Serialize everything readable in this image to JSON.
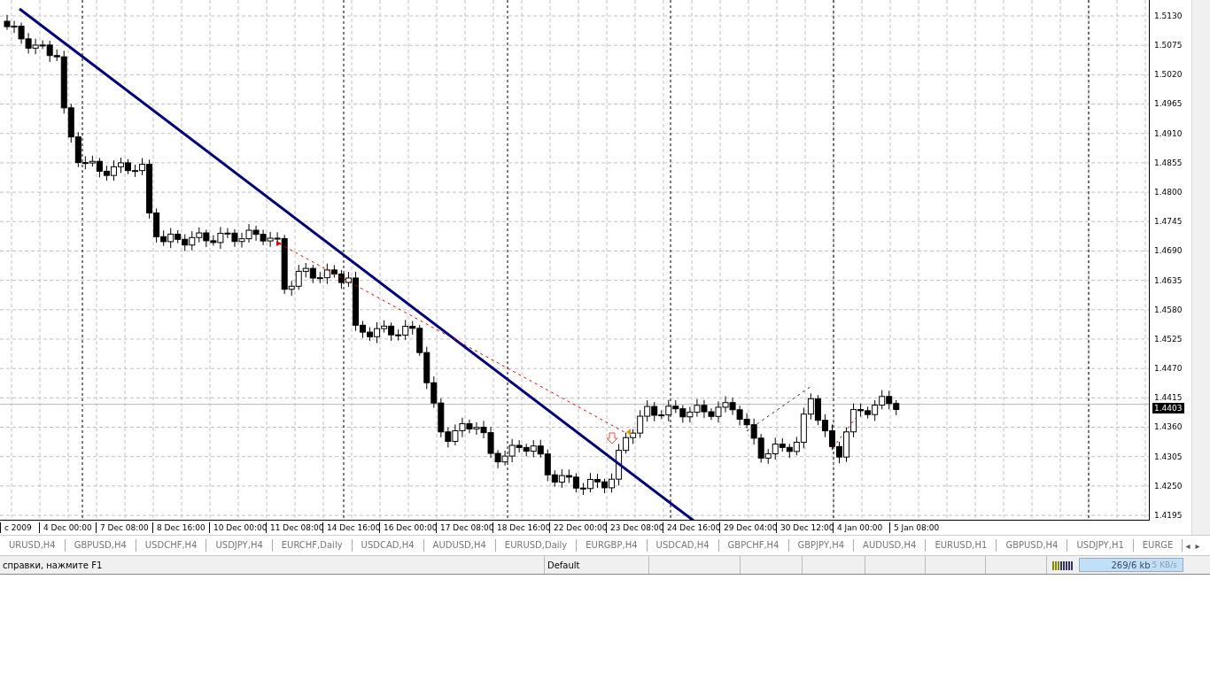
{
  "chart": {
    "price_labels": [
      "1.5130",
      "1.5075",
      "1.5020",
      "1.4965",
      "1.4910",
      "1.4855",
      "1.4800",
      "1.4745",
      "1.4690",
      "1.4635",
      "1.4580",
      "1.4525",
      "1.4470",
      "1.4415",
      "1.4360",
      "1.4305",
      "1.4250",
      "1.4195"
    ],
    "current_price": "1.4403",
    "time_labels": [
      "c 2009",
      "4 Dec 00:00",
      "7 Dec 08:00",
      "8 Dec 16:00",
      "10 Dec 00:00",
      "11 Dec 08:00",
      "14 Dec 16:00",
      "16 Dec 00:00",
      "17 Dec 08:00",
      "18 Dec 16:00",
      "22 Dec 00:00",
      "23 Dec 08:00",
      "24 Dec 16:00",
      "29 Dec 04:00",
      "30 Dec 12:00",
      "4 Jan 00:00",
      "5 Jan 08:00"
    ]
  },
  "tabs": [
    {
      "label": "URUSD,H4"
    },
    {
      "label": "GBPUSD,H4"
    },
    {
      "label": "USDCHF,H4"
    },
    {
      "label": "USDJPY,H4"
    },
    {
      "label": "EURCHF,Daily"
    },
    {
      "label": "USDCAD,H4"
    },
    {
      "label": "AUDUSD,H4"
    },
    {
      "label": "EURUSD,Daily"
    },
    {
      "label": "EURGBP,H4"
    },
    {
      "label": "USDCAD,H4"
    },
    {
      "label": "GBPCHF,H4"
    },
    {
      "label": "GBPJPY,H4"
    },
    {
      "label": "AUDUSD,H4"
    },
    {
      "label": "EURUSD,H1"
    },
    {
      "label": "GBPUSD,H4"
    },
    {
      "label": "USDJPY,H1"
    },
    {
      "label": "EURGE"
    }
  ],
  "tab_scroll": [
    "◂",
    "▸"
  ],
  "status_bar": {
    "help": "справки, нажмите F1",
    "profile": "Default",
    "traffic": "269/6 kb",
    "speed": "5 KB/s"
  }
}
